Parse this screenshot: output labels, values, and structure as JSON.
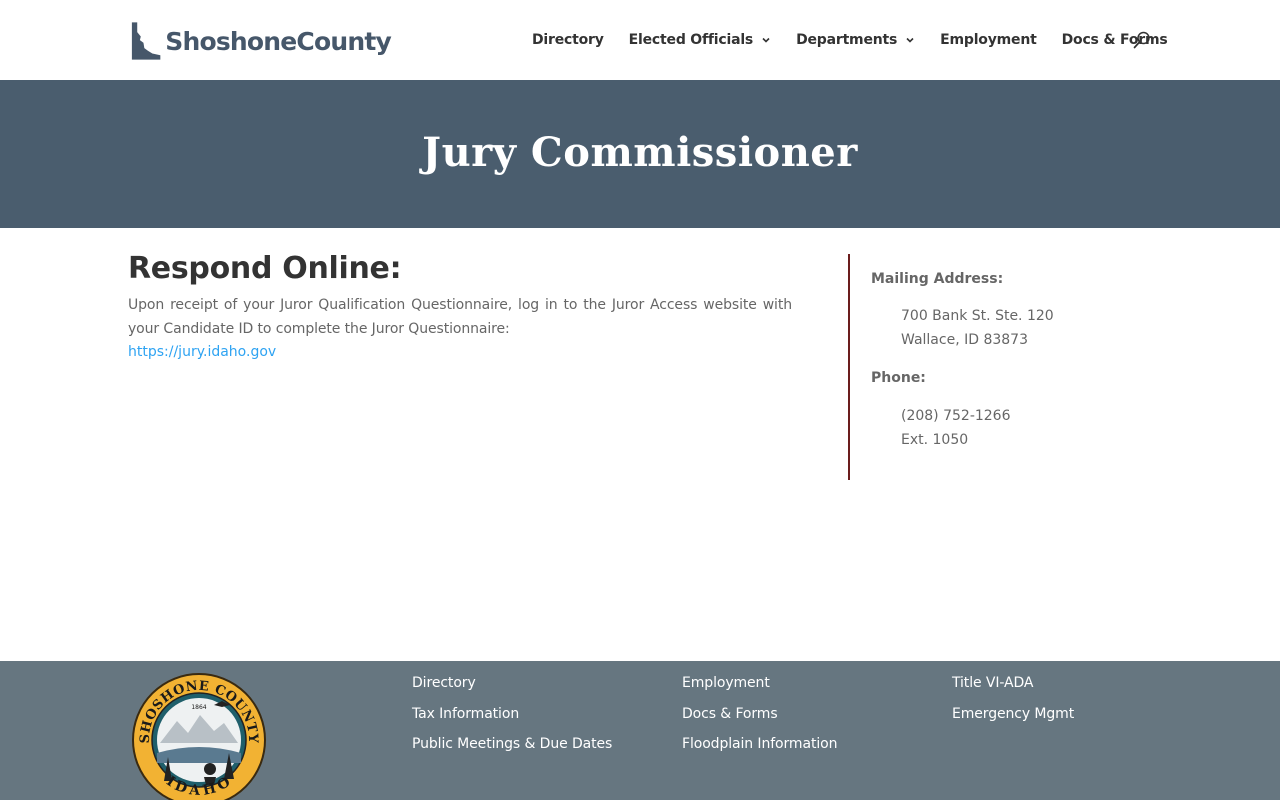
{
  "site": {
    "logo_text": "ShoshoneCounty",
    "brand_color": "#46576a"
  },
  "nav": {
    "items": [
      {
        "label": "Directory",
        "dropdown": false
      },
      {
        "label": "Elected Officials",
        "dropdown": true
      },
      {
        "label": "Departments",
        "dropdown": true
      },
      {
        "label": "Employment",
        "dropdown": false
      },
      {
        "label": "Docs & Forms",
        "dropdown": false
      }
    ],
    "search_icon": "search-icon"
  },
  "hero": {
    "title": "Jury Commissioner",
    "background": "#4a5d6e"
  },
  "main": {
    "heading": "Respond Online:",
    "paragraph": "Upon receipt of your Juror Qualification Questionnaire, log in to the Juror Access website with your Candidate ID to complete the Juror Questionnaire:",
    "link_text": "https://jury.idaho.gov",
    "link_color": "#2ea3f2"
  },
  "sidebar": {
    "mailing_label": "Mailing Address:",
    "address_line1": "700 Bank St. Ste. 120",
    "address_line2": "Wallace, ID 83873",
    "phone_label": "Phone:",
    "phone": "(208) 752-1266",
    "ext": "Ext. 1050",
    "accent_color": "#6b1d1d"
  },
  "footer": {
    "seal_top_text": "SHOSHONE COUNTY",
    "seal_bottom_text": "IDAHO",
    "seal_year": "1864",
    "columns": [
      [
        "Directory",
        "Tax Information",
        "Public Meetings & Due Dates"
      ],
      [
        "Employment",
        "Docs & Forms",
        "Floodplain Information"
      ],
      [
        "Title VI-ADA",
        "Emergency Mgmt"
      ]
    ],
    "background": "#667680"
  }
}
